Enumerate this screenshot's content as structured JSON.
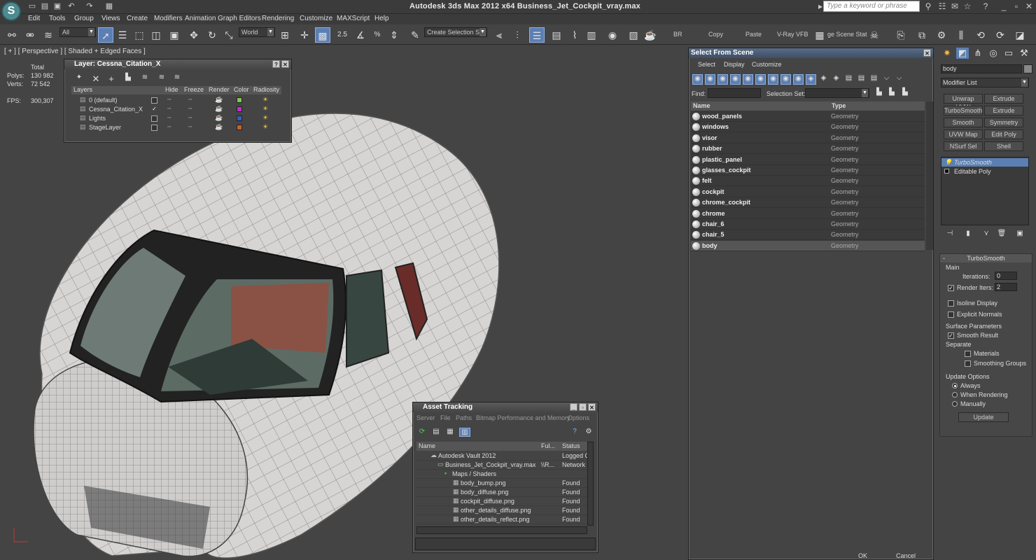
{
  "app": {
    "title": "Autodesk 3ds Max  2012 x64     Business_Jet_Cockpit_vray.max",
    "logo_letter": "S",
    "search_placeholder": "Type a keyword or phrase"
  },
  "menu": [
    "Edit",
    "Tools",
    "Group",
    "Views",
    "Create",
    "Modifiers",
    "Animation",
    "Graph Editors",
    "Rendering",
    "Customize",
    "MAXScript",
    "Help"
  ],
  "toolbar": {
    "filter": "All",
    "coord": "World",
    "create_selection_set": "Create Selection Se",
    "snap_value": "2.5",
    "percent": "%",
    "texts": [
      "BR",
      "Copy",
      "Paste",
      "V-Ray VFB",
      "ge Scene Stat"
    ]
  },
  "viewport": {
    "label": "[ + ] [ Perspective ] [ Shaded + Edged Faces ]",
    "stats": {
      "total_label": "Total",
      "polys_label": "Polys:",
      "polys": "130 982",
      "verts_label": "Verts:",
      "verts": "72 542",
      "fps_label": "FPS:",
      "fps": "300,307"
    }
  },
  "layer_panel": {
    "title": "Layer: Cessna_Citation_X",
    "columns": [
      "Layers",
      "Hide",
      "Freeze",
      "Render",
      "Color",
      "Radiosity"
    ],
    "rows": [
      {
        "name": "0 (default)",
        "color": "#7ec84a",
        "checked": false
      },
      {
        "name": "Cessna_Citation_X",
        "color": "#c030c0",
        "checked": true
      },
      {
        "name": "Lights",
        "color": "#3060c0",
        "checked": false
      },
      {
        "name": "StageLayer",
        "color": "#d06020",
        "checked": false
      }
    ]
  },
  "select_from_scene": {
    "title": "Select From Scene",
    "menus": [
      "Select",
      "Display",
      "Customize"
    ],
    "find_label": "Find:",
    "selection_set_label": "Selection Set:",
    "columns": [
      "Name",
      "Type"
    ],
    "rows": [
      {
        "name": "wood_panels",
        "type": "Geometry"
      },
      {
        "name": "windows",
        "type": "Geometry"
      },
      {
        "name": "visor",
        "type": "Geometry"
      },
      {
        "name": "rubber",
        "type": "Geometry"
      },
      {
        "name": "plastic_panel",
        "type": "Geometry"
      },
      {
        "name": "glasses_cockpit",
        "type": "Geometry"
      },
      {
        "name": "felt",
        "type": "Geometry"
      },
      {
        "name": "cockpit",
        "type": "Geometry"
      },
      {
        "name": "chrome_cockpit",
        "type": "Geometry"
      },
      {
        "name": "chrome",
        "type": "Geometry"
      },
      {
        "name": "chair_6",
        "type": "Geometry"
      },
      {
        "name": "chair_5",
        "type": "Geometry"
      },
      {
        "name": "body",
        "type": "Geometry"
      }
    ],
    "ok": "OK",
    "cancel": "Cancel"
  },
  "asset_tracking": {
    "title": "Asset Tracking",
    "menus": [
      "Server",
      "File",
      "Paths",
      "Bitmap Performance and Memory",
      "Options"
    ],
    "columns": [
      "Name",
      "Ful...",
      "Status"
    ],
    "rows": [
      {
        "name": "Autodesk Vault 2012",
        "full": "",
        "status": "Logged O"
      },
      {
        "name": "Business_Jet_Cockpit_vray.max",
        "full": "\\\\R...",
        "status": "Network"
      },
      {
        "name": "Maps / Shaders",
        "full": "",
        "status": ""
      },
      {
        "name": "body_bump.png",
        "full": "",
        "status": "Found"
      },
      {
        "name": "body_diffuse.png",
        "full": "",
        "status": "Found"
      },
      {
        "name": "cockpit_diffuse.png",
        "full": "",
        "status": "Found"
      },
      {
        "name": "other_details_diffuse.png",
        "full": "",
        "status": "Found"
      },
      {
        "name": "other_details_reflect.png",
        "full": "",
        "status": "Found"
      }
    ]
  },
  "command_panel": {
    "object_name": "body",
    "modifier_list": "Modifier List",
    "buttons": [
      "Unwrap UVW",
      "Extrude",
      "TurboSmooth",
      "Extrude",
      "Smooth",
      "Symmetry",
      "UVW Map",
      "Edit Poly",
      "NSurf Sel",
      "Shell"
    ],
    "stack": [
      "TurboSmooth",
      "Editable Poly"
    ],
    "rollout_title": "TurboSmooth",
    "main": "Main",
    "iterations_label": "Iterations:",
    "iterations": "0",
    "render_iters_label": "Render Iters:",
    "render_iters": "2",
    "isoline": "Isoline Display",
    "explicit": "Explicit Normals",
    "surface_params": "Surface Parameters",
    "smooth_result": "Smooth Result",
    "separate": "Separate",
    "materials": "Materials",
    "smoothing_groups": "Smoothing Groups",
    "update_options": "Update Options",
    "always": "Always",
    "when_rendering": "When Rendering",
    "manually": "Manually",
    "update": "Update"
  }
}
